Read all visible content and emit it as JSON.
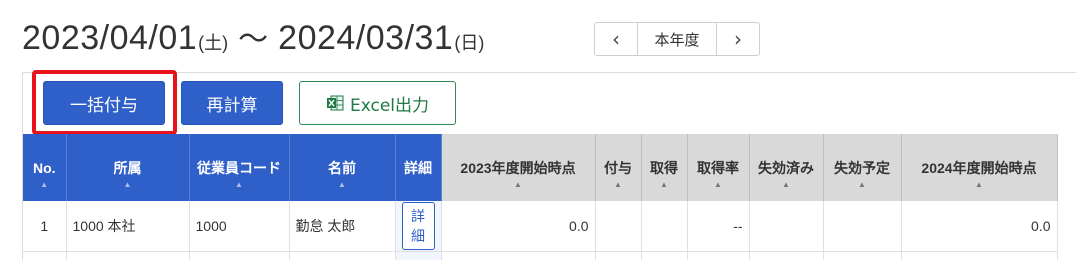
{
  "period": {
    "start_date": "2023/04/01",
    "start_dow": "(土)",
    "separator": "〜",
    "end_date": "2024/03/31",
    "end_dow": "(日)"
  },
  "year_nav": {
    "prev_icon": "chevron-left-icon",
    "label": "本年度",
    "next_icon": "chevron-right-icon",
    "prev_glyph": "‹",
    "next_glyph": "›"
  },
  "toolbar": {
    "bulk_grant_label": "一括付与",
    "recalc_label": "再計算",
    "excel_label": "Excel出力",
    "excel_icon": "excel-icon"
  },
  "colors": {
    "primary": "#2f5fc9",
    "highlight": "#e8121b",
    "excel_green": "#1f7a44",
    "header_gray": "#d9d9d9"
  },
  "table": {
    "columns": [
      {
        "label": "No.",
        "style": "blue",
        "sortable": true
      },
      {
        "label": "所属",
        "style": "blue",
        "sortable": true
      },
      {
        "label": "従業員コード",
        "style": "blue",
        "sortable": true
      },
      {
        "label": "名前",
        "style": "blue",
        "sortable": true
      },
      {
        "label": "詳細",
        "style": "blue",
        "sortable": false
      },
      {
        "label": "2023年度開始時点",
        "style": "gray",
        "sortable": true
      },
      {
        "label": "付与",
        "style": "gray",
        "sortable": true
      },
      {
        "label": "取得",
        "style": "gray",
        "sortable": true
      },
      {
        "label": "取得率",
        "style": "gray",
        "sortable": true
      },
      {
        "label": "失効済み",
        "style": "gray",
        "sortable": true
      },
      {
        "label": "失効予定",
        "style": "gray",
        "sortable": true
      },
      {
        "label": "2024年度開始時点",
        "style": "gray",
        "sortable": true
      }
    ],
    "sort_glyph": "▲",
    "rows": [
      {
        "no": "1",
        "dept": "1000 本社",
        "code": "1000",
        "name": "勤怠 太郎",
        "detail": "詳細",
        "start_2023": "0.0",
        "grant": "",
        "taken": "",
        "rate": "--",
        "expired": "",
        "expiring": "",
        "start_2024": "0.0"
      }
    ]
  }
}
